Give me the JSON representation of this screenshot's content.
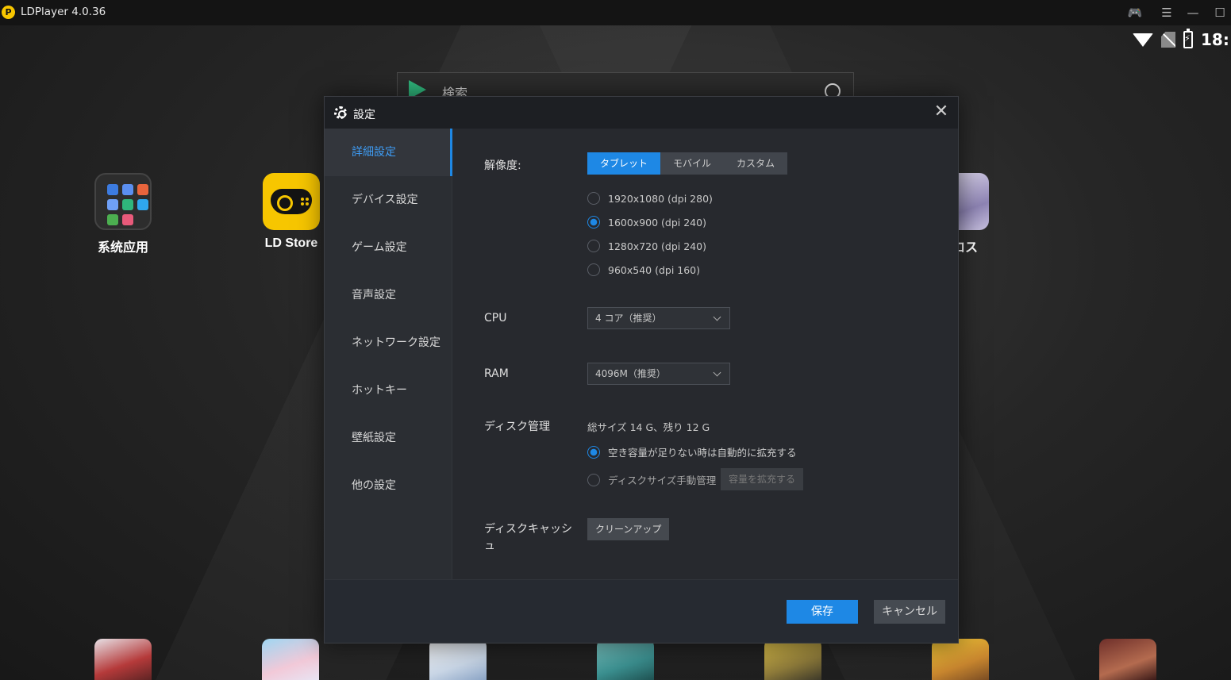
{
  "window": {
    "title": "LDPlayer 4.0.36",
    "logo_letter": "P"
  },
  "android_status": {
    "clock": "18:"
  },
  "desktop": {
    "search_placeholder": "検索",
    "icons": [
      {
        "label": "系统应用"
      },
      {
        "label": "LD Store"
      },
      {
        "label": "ロス"
      }
    ]
  },
  "dialog": {
    "title": "設定",
    "nav": [
      {
        "label": "詳細設定",
        "active": true
      },
      {
        "label": "デバイス設定"
      },
      {
        "label": "ゲーム設定"
      },
      {
        "label": "音声設定"
      },
      {
        "label": "ネットワーク設定"
      },
      {
        "label": "ホットキー"
      },
      {
        "label": "壁紙設定"
      },
      {
        "label": "他の設定"
      }
    ],
    "resolution": {
      "label": "解像度:",
      "tabs": [
        "タブレット",
        "モバイル",
        "カスタム"
      ],
      "selected_tab": "タブレット",
      "options": [
        {
          "text": "1920x1080  (dpi 280)",
          "selected": false
        },
        {
          "text": "1600x900  (dpi 240)",
          "selected": true
        },
        {
          "text": "1280x720  (dpi 240)",
          "selected": false
        },
        {
          "text": "960x540  (dpi 160)",
          "selected": false
        }
      ]
    },
    "cpu": {
      "label": "CPU",
      "value": "4 コア（推奨）"
    },
    "ram": {
      "label": "RAM",
      "value": "4096M（推奨）"
    },
    "disk": {
      "label": "ディスク管理",
      "info": "総サイズ 14 G、残り 12 G",
      "auto_option": "空き容量が足りない時は自動的に拡充する",
      "manual_option": "ディスクサイズ手動管理",
      "expand_button": "容量を拡充する"
    },
    "cache": {
      "label_line1": "ディスクキャッシ",
      "label_line2": "ュ",
      "cleanup_button": "クリーンアップ"
    },
    "footer": {
      "save": "保存",
      "cancel": "キャンセル"
    }
  },
  "colors": {
    "accent": "#1e88e5",
    "dialog_bg": "#27292e",
    "brand_yellow": "#f7c600"
  }
}
